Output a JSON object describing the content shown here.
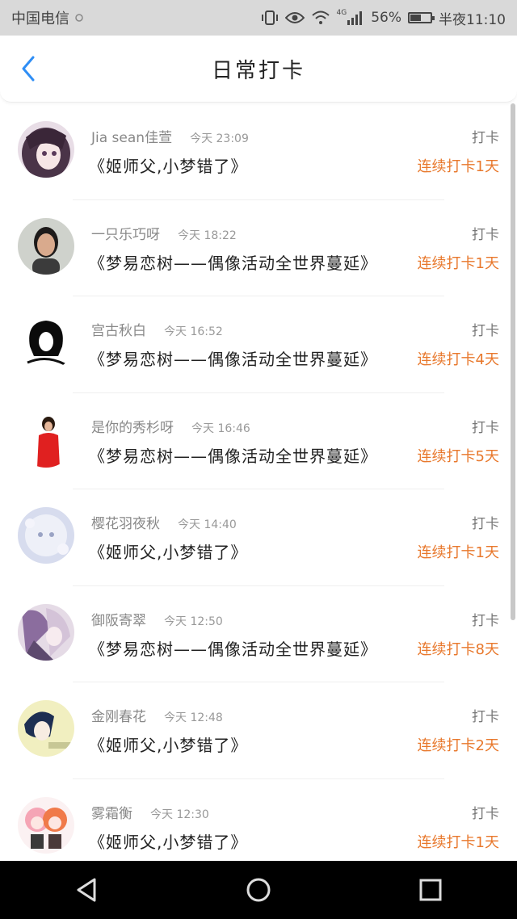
{
  "status_bar": {
    "carrier": "中国电信",
    "network": "4G",
    "battery": "56%",
    "battery_level": 0.56,
    "time": "半夜11:10"
  },
  "header": {
    "title": "日常打卡",
    "accent_color": "#2f8ef5"
  },
  "colors": {
    "streak": "#e8782c",
    "name": "#888888",
    "message": "#222222"
  },
  "items": [
    {
      "name": "Jia sean佳萱",
      "time": "今天 23:09",
      "action": "打卡",
      "message": "《姬师父,小梦错了》",
      "streak": "连续打卡1天",
      "avatar": "anime-girl-purple"
    },
    {
      "name": "一只乐巧呀",
      "time": "今天 18:22",
      "action": "打卡",
      "message": "《梦易恋树——偶像活动全世界蔓延》",
      "streak": "连续打卡1天",
      "avatar": "photo-woman"
    },
    {
      "name": "宫古秋白",
      "time": "今天 16:52",
      "action": "打卡",
      "message": "《梦易恋树——偶像活动全世界蔓延》",
      "streak": "连续打卡4天",
      "avatar": "black-hair-sketch"
    },
    {
      "name": "是你的秀杉呀",
      "time": "今天 16:46",
      "action": "打卡",
      "message": "《梦易恋树——偶像活动全世界蔓延》",
      "streak": "连续打卡5天",
      "avatar": "red-dress-figure"
    },
    {
      "name": "樱花羽夜秋",
      "time": "今天 14:40",
      "action": "打卡",
      "message": "《姬师父,小梦错了》",
      "streak": "连续打卡1天",
      "avatar": "pale-anime"
    },
    {
      "name": "御阪寄翠",
      "time": "今天 12:50",
      "action": "打卡",
      "message": "《梦易恋树——偶像活动全世界蔓延》",
      "streak": "连续打卡8天",
      "avatar": "anime-pair"
    },
    {
      "name": "金刚春花",
      "time": "今天 12:48",
      "action": "打卡",
      "message": "《姬师父,小梦错了》",
      "streak": "连续打卡2天",
      "avatar": "anime-boy-yellow"
    },
    {
      "name": "雾霜衡",
      "time": "今天 12:30",
      "action": "打卡",
      "message": "《姬师父,小梦错了》",
      "streak": "连续打卡1天",
      "avatar": "chibi-pink"
    }
  ]
}
